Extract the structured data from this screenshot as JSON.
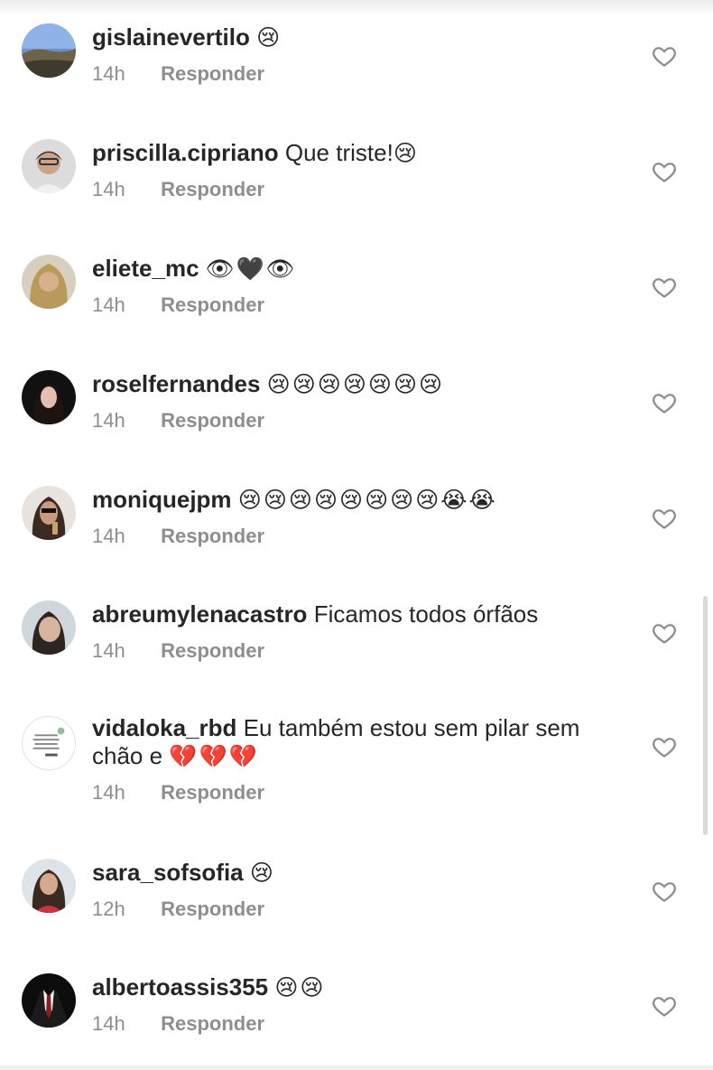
{
  "comments": [
    {
      "username": "gislainevertilo",
      "text": "",
      "emoji": "😢",
      "time": "14h",
      "reply": "Responder",
      "avatar": "landscape"
    },
    {
      "username": "priscilla.cipriano",
      "text": "Que triste!",
      "emoji": "😢",
      "time": "14h",
      "reply": "Responder",
      "avatar": "person"
    },
    {
      "username": "eliete_mc",
      "text": "",
      "emoji": "👁🖤👁",
      "time": "14h",
      "reply": "Responder",
      "avatar": "person"
    },
    {
      "username": "roselfernandes",
      "text": "",
      "emoji": "😢😢😢😢😢😢😢",
      "time": "14h",
      "reply": "Responder",
      "avatar": "person"
    },
    {
      "username": "moniquejpm",
      "text": "",
      "emoji": "😢😢😢😢😢😢😢😢😭😭",
      "time": "14h",
      "reply": "Responder",
      "avatar": "person"
    },
    {
      "username": "abreumylenacastro",
      "text": "Ficamos todos órfãos",
      "emoji": "",
      "time": "14h",
      "reply": "Responder",
      "avatar": "person"
    },
    {
      "username": "vidaloka_rbd",
      "text": "Eu também estou sem pilar sem chão e",
      "emoji": "💔💔💔",
      "time": "14h",
      "reply": "Responder",
      "avatar": "card"
    },
    {
      "username": "sara_sofsofia",
      "text": "",
      "emoji": "😢",
      "time": "12h",
      "reply": "Responder",
      "avatar": "person"
    },
    {
      "username": "albertoassis355",
      "text": "",
      "emoji": "😢😢",
      "time": "14h",
      "reply": "Responder",
      "avatar": "suit"
    }
  ],
  "icons": {
    "like": "heart-outline-icon"
  },
  "colors": {
    "text": "#262626",
    "meta": "#8e8e8e",
    "background": "#ffffff"
  }
}
